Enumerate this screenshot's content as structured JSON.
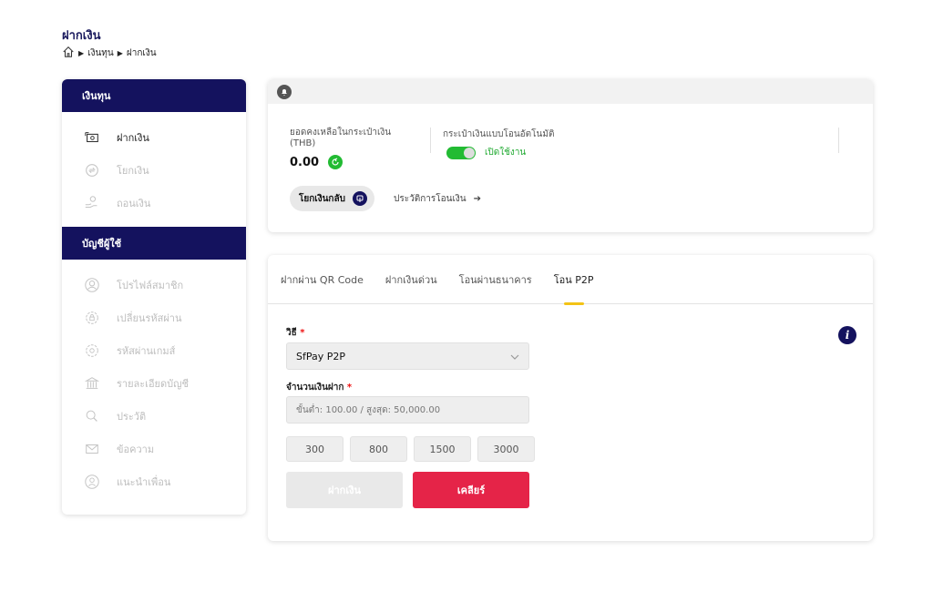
{
  "page": {
    "title": "ฝากเงิน",
    "breadcrumb": [
      "เงินทุน",
      "ฝากเงิน"
    ]
  },
  "sidebar": {
    "section1_title": "เงินทุน",
    "section1_items": [
      {
        "label": "ฝากเงิน",
        "icon": "deposit-icon"
      },
      {
        "label": "โยกเงิน",
        "icon": "transfer-icon"
      },
      {
        "label": "ถอนเงิน",
        "icon": "withdraw-icon"
      }
    ],
    "section2_title": "บัญชีผู้ใช้",
    "section2_items": [
      {
        "label": "โปรไฟล์สมาชิก",
        "icon": "profile-icon"
      },
      {
        "label": "เปลี่ยนรหัสผ่าน",
        "icon": "password-icon"
      },
      {
        "label": "รหัสผ่านเกมส์",
        "icon": "game-password-icon"
      },
      {
        "label": "รายละเอียดบัญชี",
        "icon": "bank-icon"
      },
      {
        "label": "ประวัติ",
        "icon": "history-icon"
      },
      {
        "label": "ข้อความ",
        "icon": "message-icon"
      },
      {
        "label": "แนะนำเพื่อน",
        "icon": "referral-icon"
      }
    ]
  },
  "wallet": {
    "balance_label": "ยอดคงเหลือในกระเป๋าเงิน (THB)",
    "balance_value": "0.00",
    "auto_wallet_label": "กระเป๋าเงินแบบโอนอัตโนมัติ",
    "auto_wallet_status": "เปิดใช้งาน",
    "pull_back_label": "โยกเงินกลับ",
    "history_label": "ประวัติการโอนเงิน"
  },
  "deposit": {
    "tabs": [
      "ฝากผ่าน QR Code",
      "ฝากเงินด่วน",
      "โอนผ่านธนาคาร",
      "โอน P2P"
    ],
    "active_tab": 3,
    "method_label": "วิธี",
    "method_value": "SfPay P2P",
    "amount_label": "จำนวนเงินฝาก",
    "amount_placeholder": "ขั้นต่ำ: 100.00 / สูงสุด: 50,000.00",
    "quick_amounts": [
      "300",
      "800",
      "1500",
      "3000"
    ],
    "deposit_button": "ฝากเงิน",
    "clear_button": "เคลียร์",
    "required_mark": "*",
    "info_glyph": "i"
  },
  "colors": {
    "navy": "#14125e",
    "accent_yellow": "#f3c316",
    "clear_red": "#e52448",
    "success_green": "#22bb33"
  }
}
